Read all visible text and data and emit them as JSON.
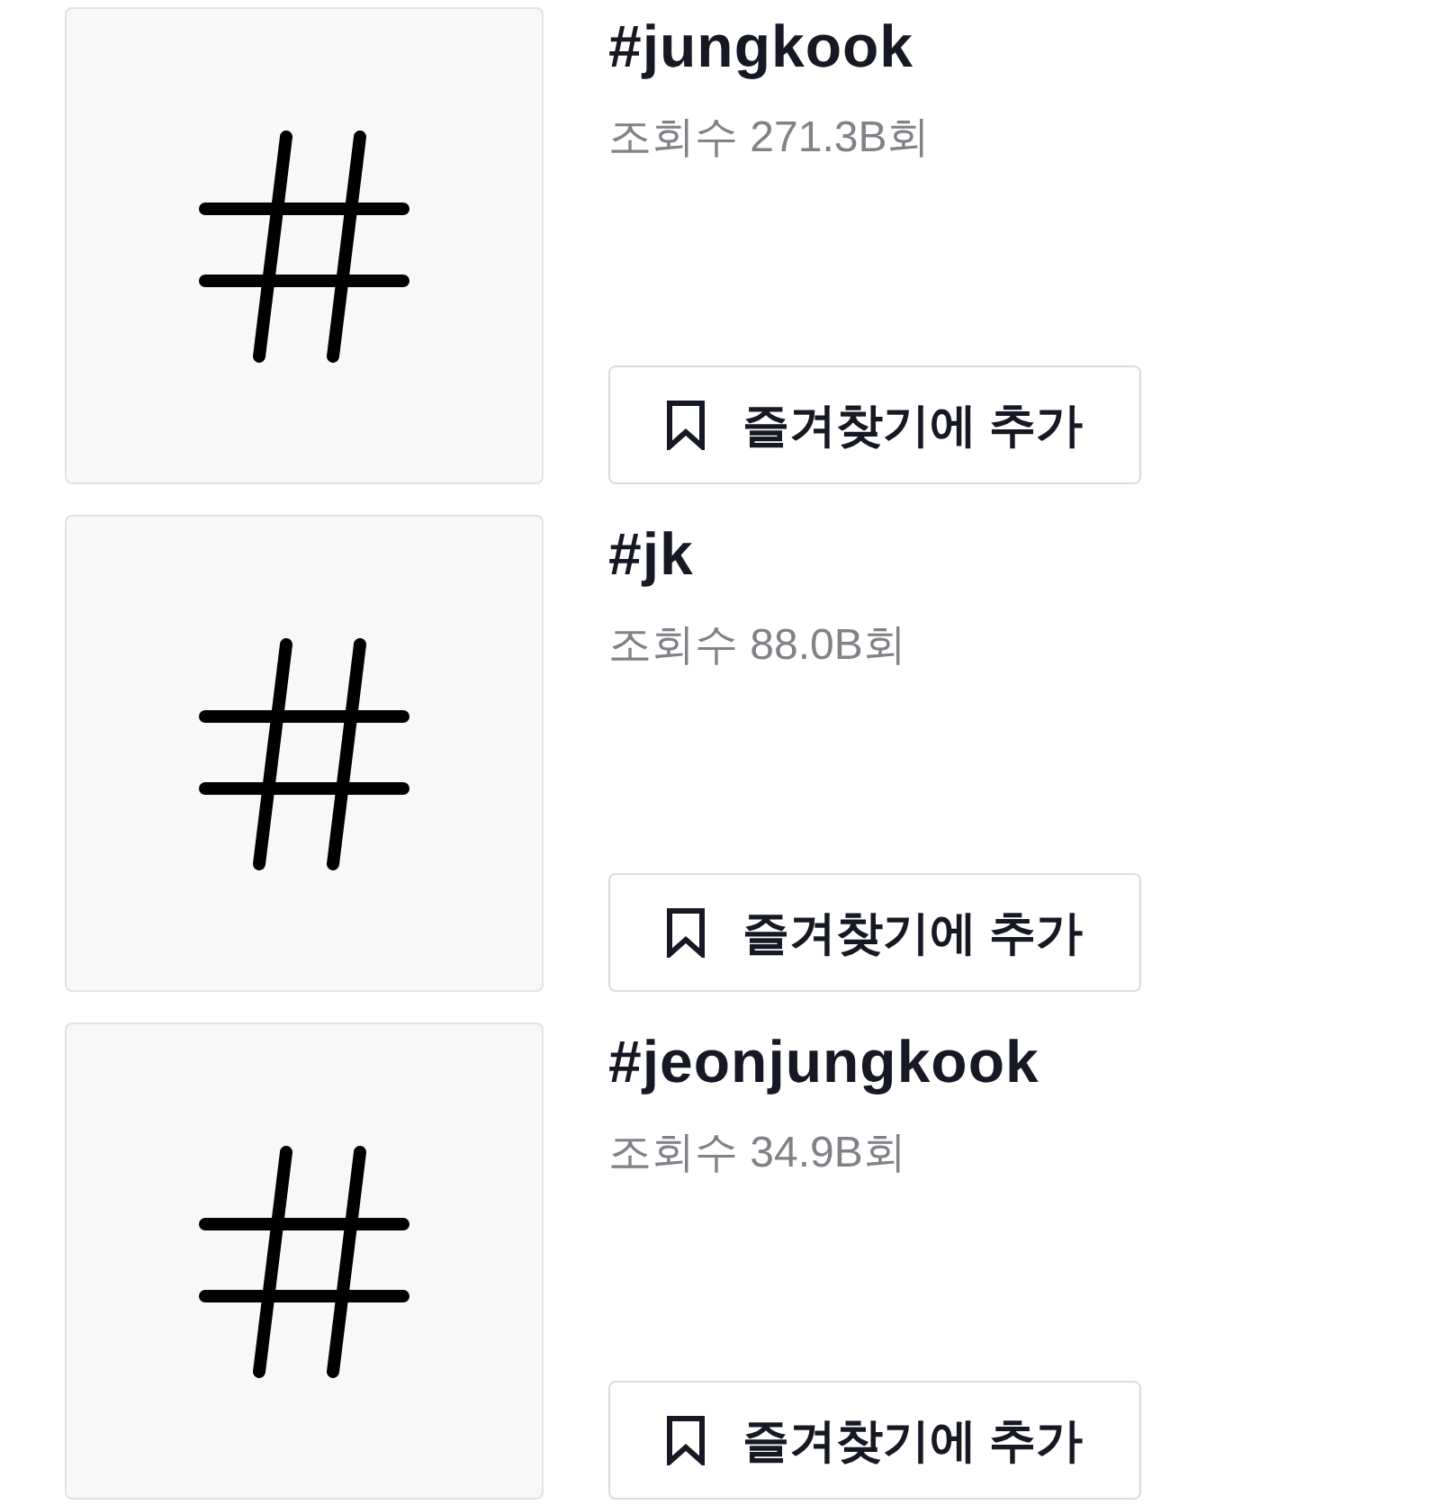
{
  "hashtags": [
    {
      "title": "#jungkook",
      "views": "조회수 271.3B회",
      "button": "즐겨찾기에 추가"
    },
    {
      "title": "#jk",
      "views": "조회수 88.0B회",
      "button": "즐겨찾기에 추가"
    },
    {
      "title": "#jeonjungkook",
      "views": "조회수 34.9B회",
      "button": "즐겨찾기에 추가"
    }
  ]
}
